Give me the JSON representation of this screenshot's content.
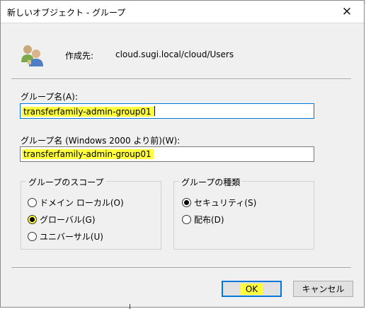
{
  "dialog": {
    "title": "新しいオブジェクト - グループ",
    "close_glyph": "✕",
    "destination_label": "作成先:",
    "destination_value": "cloud.sugi.local/cloud/Users"
  },
  "group_name": {
    "label": "グループ名(A):",
    "value": "transferfamily-admin-group01"
  },
  "group_name_pre2000": {
    "label": "グループ名 (Windows 2000 より前)(W):",
    "value": "transferfamily-admin-group01"
  },
  "scope": {
    "title": "グループのスコープ",
    "options": [
      {
        "label": "ドメイン ローカル(O)",
        "checked": false
      },
      {
        "label": "グローバル(G)",
        "checked": true
      },
      {
        "label": "ユニバーサル(U)",
        "checked": false
      }
    ]
  },
  "type": {
    "title": "グループの種類",
    "options": [
      {
        "label": "セキュリティ(S)",
        "checked": true
      },
      {
        "label": "配布(D)",
        "checked": false
      }
    ]
  },
  "buttons": {
    "ok": "OK",
    "cancel": "キャンセル"
  },
  "colors": {
    "highlight": "#ffff3b",
    "focus_border": "#0078d7",
    "dialog_bg": "#f0f0f0"
  },
  "icons": {
    "object": "group-users-icon",
    "close": "close-icon"
  }
}
